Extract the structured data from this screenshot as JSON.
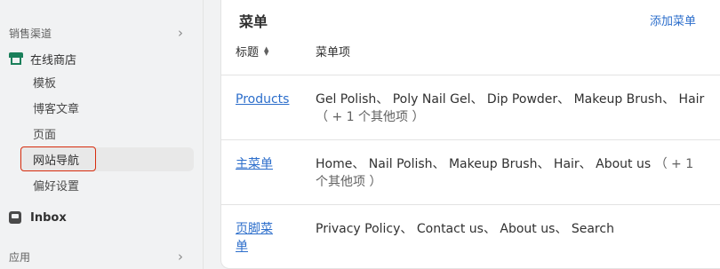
{
  "sidebar": {
    "sales_channels_label": "销售渠道",
    "online_store_label": "在线商店",
    "items": [
      {
        "label": "模板"
      },
      {
        "label": "博客文章"
      },
      {
        "label": "页面"
      },
      {
        "label": "网站导航"
      },
      {
        "label": "偏好设置"
      }
    ],
    "inbox_label": "Inbox",
    "apps_label": "应用"
  },
  "card": {
    "title": "菜单",
    "add_menu_label": "添加菜单",
    "col_title": "标题",
    "col_items": "菜单项",
    "rows": [
      {
        "title": "Products",
        "items": "Gel Polish、 Poly Nail Gel、 Dip Powder、 Makeup Brush、 Hair",
        "more": "（ + 1 个其他项 ）"
      },
      {
        "title": "主菜单",
        "items": "Home、 Nail Polish、 Makeup Brush、 Hair、 About us",
        "more": "（ + 1 个其他项 ）"
      },
      {
        "title": "页脚菜单",
        "items": "Privacy Policy、 Contact us、 About us、 Search",
        "more": ""
      }
    ]
  }
}
